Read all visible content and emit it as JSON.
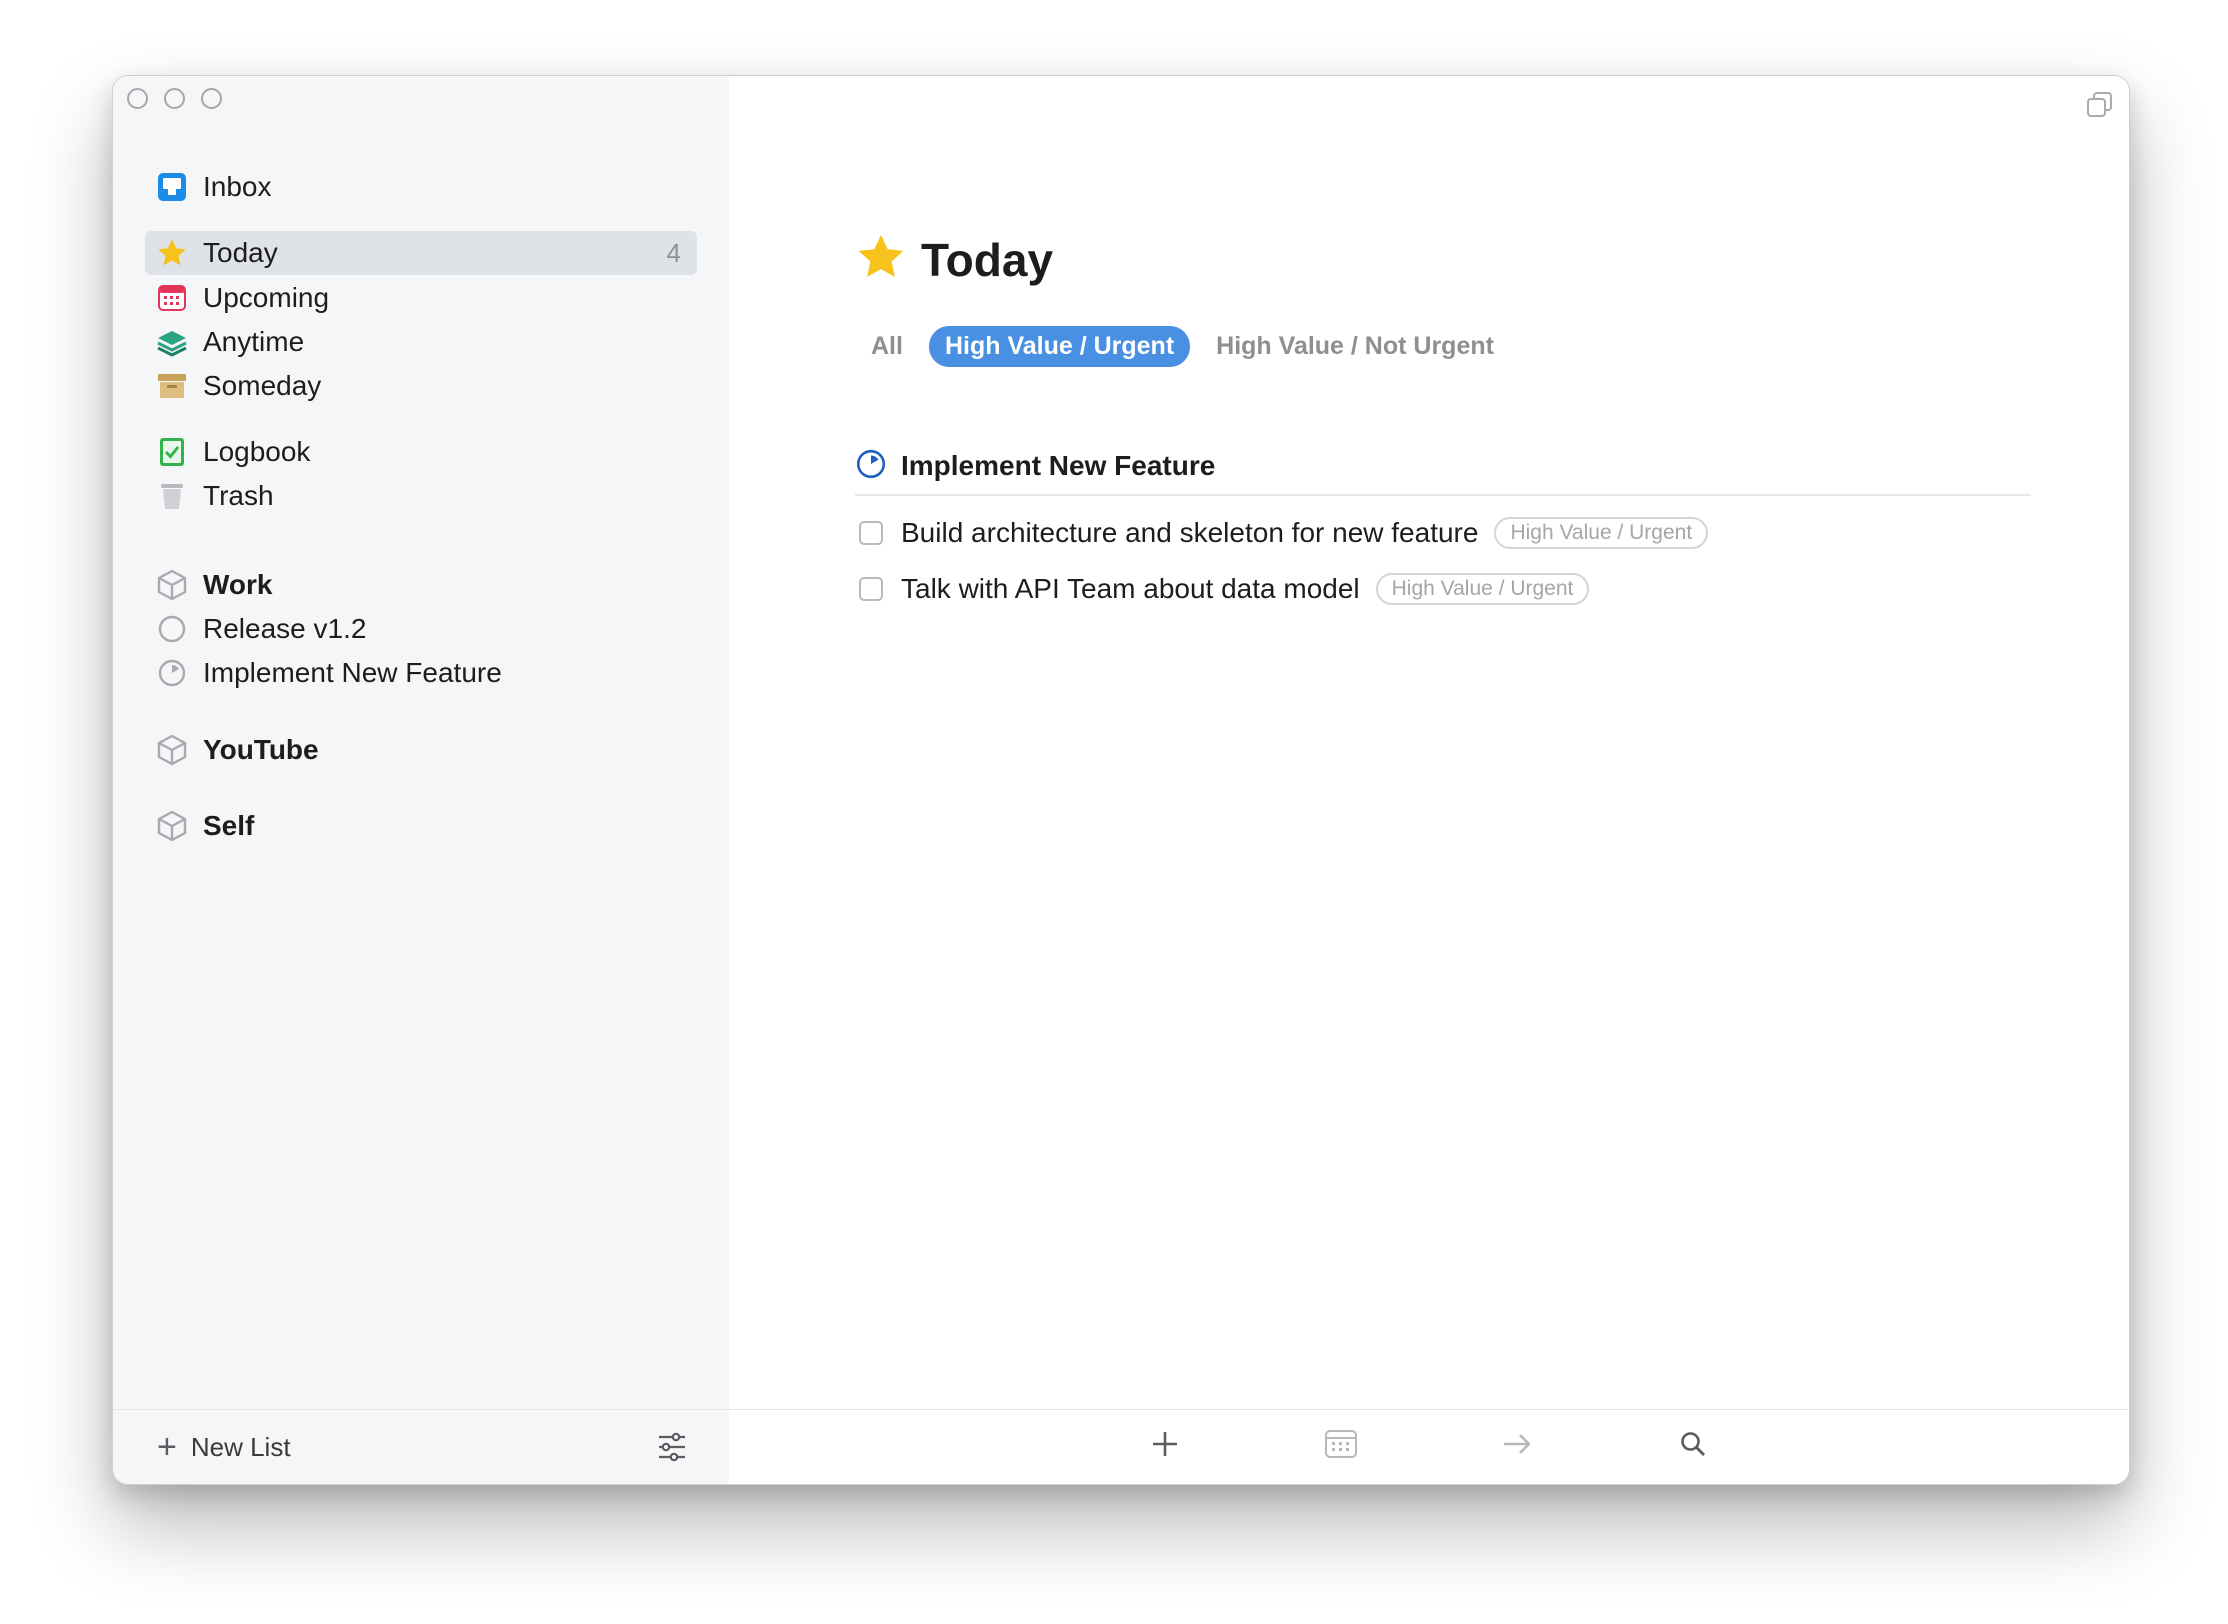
{
  "sidebar": {
    "items": [
      {
        "label": "Inbox",
        "icon": "inbox-icon"
      },
      {
        "label": "Today",
        "icon": "star-icon",
        "count": "4",
        "selected": true
      },
      {
        "label": "Upcoming",
        "icon": "calendar-icon"
      },
      {
        "label": "Anytime",
        "icon": "layers-icon"
      },
      {
        "label": "Someday",
        "icon": "archive-box-icon"
      },
      {
        "label": "Logbook",
        "icon": "logbook-check-icon"
      },
      {
        "label": "Trash",
        "icon": "trash-icon"
      }
    ],
    "areas": [
      {
        "label": "Work",
        "icon": "cube-icon"
      },
      {
        "label": "Release v1.2",
        "icon": "empty-circle-icon"
      },
      {
        "label": "Implement New Feature",
        "icon": "progress-circle-icon"
      },
      {
        "label": "YouTube",
        "icon": "cube-icon"
      },
      {
        "label": "Self",
        "icon": "cube-icon"
      }
    ],
    "footer": {
      "new_list_label": "New List"
    }
  },
  "main": {
    "title": "Today",
    "filters": [
      "All",
      "High Value / Urgent",
      "High Value / Not Urgent"
    ],
    "active_filter": "High Value / Urgent",
    "project": {
      "title": "Implement New Feature"
    },
    "tasks": [
      {
        "text": "Build architecture and skeleton for new feature",
        "tag": "High Value / Urgent",
        "done": false
      },
      {
        "text": "Talk with API Team about data model",
        "tag": "High Value / Urgent",
        "done": false
      }
    ]
  },
  "colors": {
    "accent": "#4a90e2",
    "star": "#f7c21b",
    "inbox": "#1c8ce6",
    "upcoming": "#e3355b",
    "anytime": "#2aa383",
    "someday": "#c9a35c",
    "logbook": "#35b24b",
    "project_progress": "#1d5fbf"
  }
}
